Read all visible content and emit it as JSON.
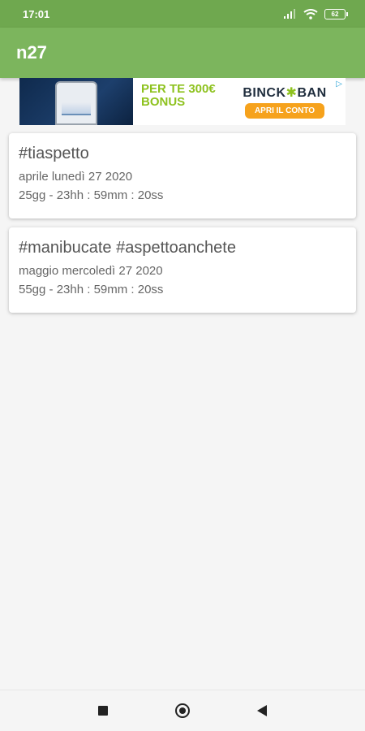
{
  "status_bar": {
    "time": "17:01",
    "battery": "62"
  },
  "app_bar": {
    "title": "n27"
  },
  "ad": {
    "headline_line1": "PER TE 300€",
    "headline_line2": "BONUS",
    "brand": "BINCK",
    "brand_suffix": "BAN",
    "cta": "APRI IL CONTO",
    "icons": {
      "ad_choice": "ad-choice-icon"
    }
  },
  "cards": [
    {
      "title": "#tiaspetto",
      "date": "aprile lunedì 27 2020",
      "countdown": "25gg - 23hh : 59mm : 20ss"
    },
    {
      "title": "#manibucate #aspettoanchete",
      "date": "maggio mercoledì 27 2020",
      "countdown": "55gg - 23hh : 59mm : 20ss"
    }
  ],
  "colors": {
    "status_bar": "#6fa84f",
    "app_bar": "#7cb55d",
    "ad_green": "#8ec21f",
    "ad_orange": "#f6a21c"
  },
  "nav": {
    "icons": [
      "recents-icon",
      "home-icon",
      "back-icon"
    ]
  }
}
